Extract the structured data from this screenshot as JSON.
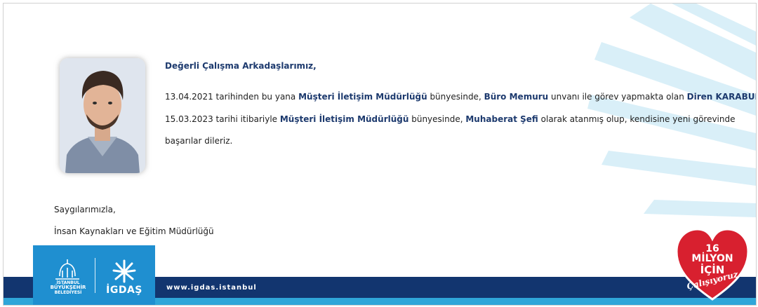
{
  "letter": {
    "greeting": "Değerli Çalışma Arkadaşlarımız,",
    "line1": {
      "a": "13.04.2021 tarihinden bu yana ",
      "b": "Müşteri İletişim Müdürlüğü",
      "c": " bünyesinde, ",
      "d": "Büro Memuru",
      "e": " unvanı ile görev yapmakta olan ",
      "f": "Diren KARABULUT",
      "g": ","
    },
    "line2": {
      "a": "15.03.2023 tarihi itibariyle ",
      "b": "Müşteri İletişim Müdürlüğü",
      "c": " bünyesinde, ",
      "d": "Muhaberat Şefi",
      "e": " olarak atanmış olup, kendisine yeni görevinde"
    },
    "line3": "başarılar dileriz.",
    "closing": "Saygılarımızla,",
    "department": "İnsan Kaynakları ve Eğitim Müdürlüğü"
  },
  "footer": {
    "ibb_logo_text": [
      "İSTANBUL",
      "BÜYÜKŞEHİR",
      "BELEDİYESİ"
    ],
    "igdas_logo_text": "İGDAŞ",
    "website": "www.igdas.istanbul",
    "campaign": [
      "16",
      "MİLYON",
      "İÇİN",
      "Çalışıyoruz"
    ]
  },
  "colors": {
    "navy": "#12356f",
    "blue": "#1f8fd0",
    "light_blue": "#2fa6d9",
    "heart_red": "#d8202f"
  }
}
